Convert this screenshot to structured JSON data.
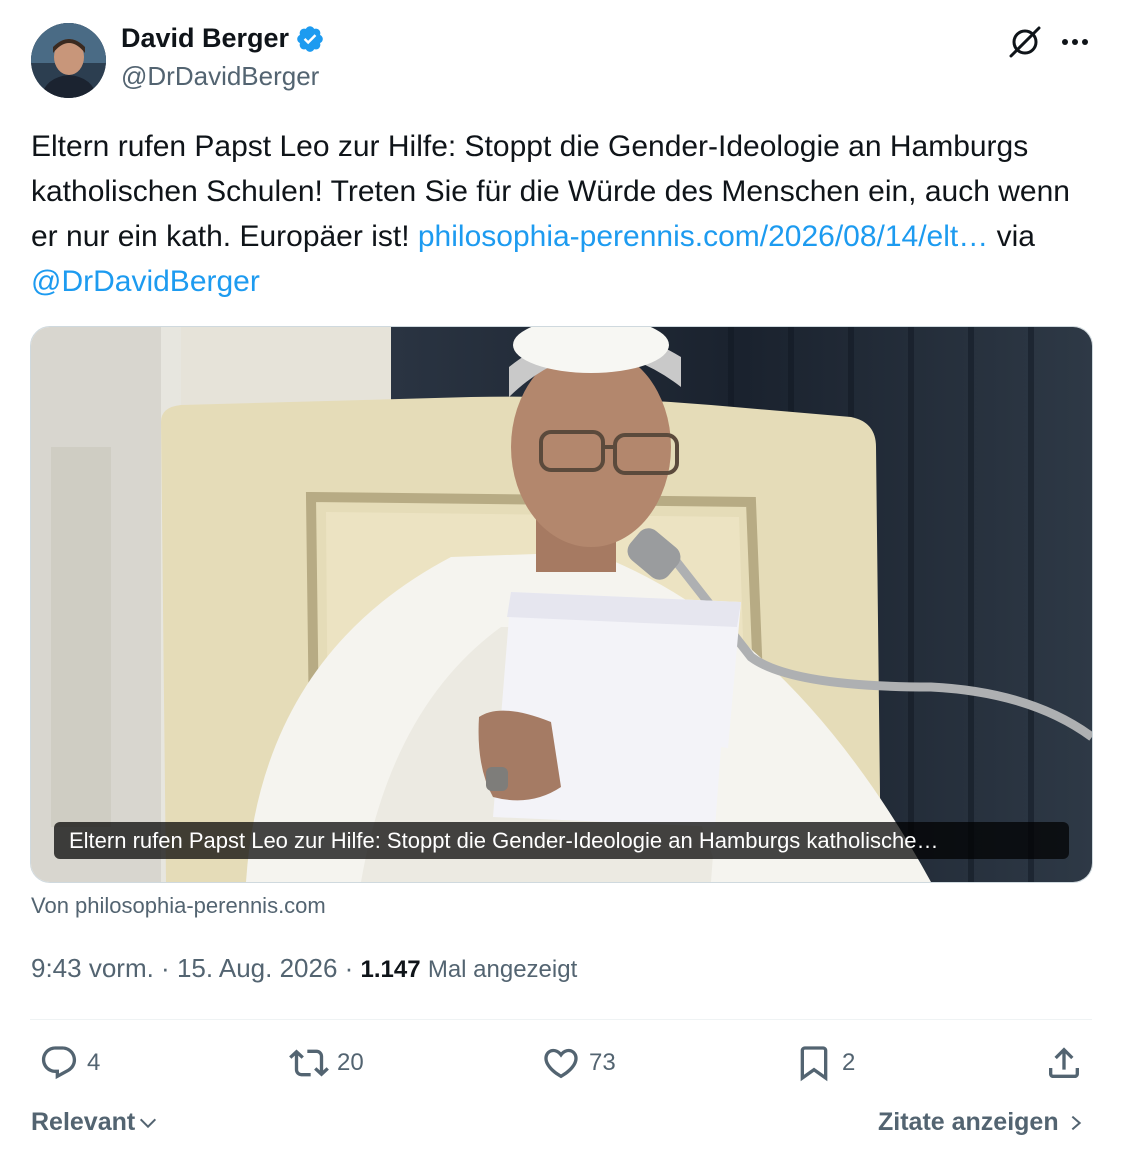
{
  "author": {
    "name": "David Berger",
    "handle": "@DrDavidBerger",
    "verified": true
  },
  "tweet": {
    "text_before_link": "Eltern rufen Papst Leo zur Hilfe: Stoppt die Gender-Ideologie an Hamburgs katholischen Schulen! Treten Sie für die Würde des Menschen ein, auch wenn er nur ein kath. Europäer ist! ",
    "link_text": "philosophia-perennis.com/2026/08/14/elt…",
    "via_text": " via ",
    "mention_text": "@DrDavidBerger"
  },
  "card": {
    "caption": "Eltern rufen Papst Leo zur Hilfe: Stoppt die Gender-Ideologie an Hamburgs katholische…",
    "source": "Von philosophia-perennis.com"
  },
  "meta": {
    "time": "9:43 vorm.",
    "separator": " · ",
    "date": "15. Aug. 2026",
    "views_count": "1.147",
    "views_label": "Mal angezeigt"
  },
  "actions": {
    "replies": "4",
    "reposts": "20",
    "likes": "73",
    "bookmarks": "2"
  },
  "footer": {
    "sort_label": "Relevant",
    "quotes_label": "Zitate anzeigen"
  },
  "colors": {
    "link": "#1d9bf0",
    "text": "#0f1419",
    "secondary": "#536471",
    "verified": "#1d9bf0"
  }
}
